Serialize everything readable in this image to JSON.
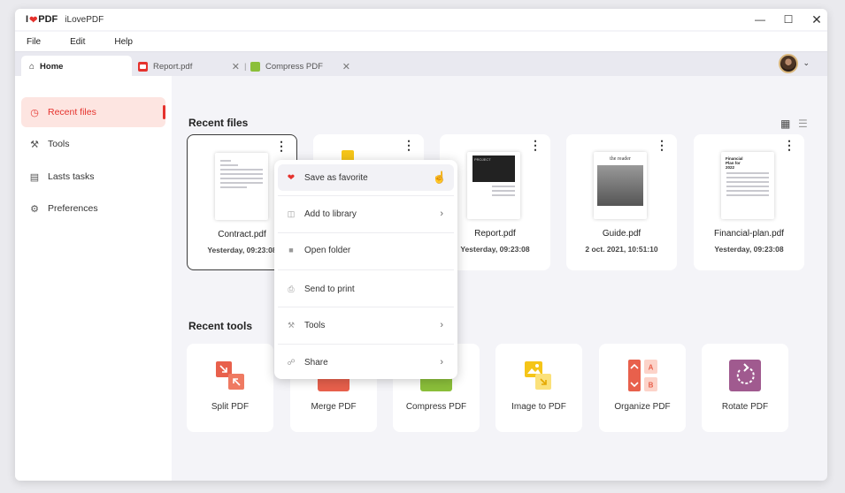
{
  "app": {
    "logo_text": "PDF",
    "logo_prefix": "I",
    "title": "iLovePDF"
  },
  "menus": [
    "File",
    "Edit",
    "Help"
  ],
  "tabs": [
    {
      "label": "Home",
      "icon": "home-icon",
      "active": true
    },
    {
      "label": "Report.pdf",
      "icon": "pdf-file-icon",
      "active": false
    },
    {
      "label": "Compress PDF",
      "icon": "compress-tool-icon",
      "active": false
    }
  ],
  "sidebar": {
    "items": [
      {
        "label": "Recent files",
        "icon": "clock-icon",
        "active": true
      },
      {
        "label": "Tools",
        "icon": "wrench-icon",
        "active": false
      },
      {
        "label": "Lasts tasks",
        "icon": "clipboard-icon",
        "active": false
      },
      {
        "label": "Preferences",
        "icon": "gear-icon",
        "active": false
      }
    ]
  },
  "recent_files": {
    "title": "Recent files",
    "files": [
      {
        "name": "Contract.pdf",
        "date": "Yesterday, 09:23:08"
      },
      {
        "name": "",
        "date": ""
      },
      {
        "name": "Report.pdf",
        "date": "Yesterday, 09:23:08"
      },
      {
        "name": "Guide.pdf",
        "date": "2 oct. 2021, 10:51:10"
      },
      {
        "name": "Financial-plan.pdf",
        "date": "Yesterday, 09:23:08"
      }
    ],
    "thumb_texts": {
      "report_title": "PROJECT",
      "guide_title": "the reader",
      "financial_title": "Financial Plan for 2022"
    }
  },
  "recent_tools": {
    "title": "Recent tools",
    "tools": [
      {
        "label": "Split PDF",
        "icon": "split-pdf-icon",
        "color": "#e8604c"
      },
      {
        "label": "Merge PDF",
        "icon": "merge-pdf-icon",
        "color": "#e8604c"
      },
      {
        "label": "Compress PDF",
        "icon": "compress-pdf-icon",
        "color": "#8bbf3a"
      },
      {
        "label": "Image to PDF",
        "icon": "image-to-pdf-icon",
        "color": "#f5c518"
      },
      {
        "label": "Organize PDF",
        "icon": "organize-pdf-icon",
        "color": "#e8604c"
      },
      {
        "label": "Rotate PDF",
        "icon": "rotate-pdf-icon",
        "color": "#a05a8f"
      }
    ]
  },
  "context_menu": {
    "items": [
      {
        "label": "Save as favorite",
        "icon": "heart-icon",
        "submenu": false
      },
      {
        "label": "Add to library",
        "icon": "library-icon",
        "submenu": true
      },
      {
        "label": "Open folder",
        "icon": "folder-icon",
        "submenu": false
      },
      {
        "label": "Send to print",
        "icon": "printer-icon",
        "submenu": false
      },
      {
        "label": "Tools",
        "icon": "wrench-icon",
        "submenu": true
      },
      {
        "label": "Share",
        "icon": "share-icon",
        "submenu": true
      }
    ]
  },
  "colors": {
    "accent": "#e5322d",
    "active_bg": "#fde5e1"
  }
}
